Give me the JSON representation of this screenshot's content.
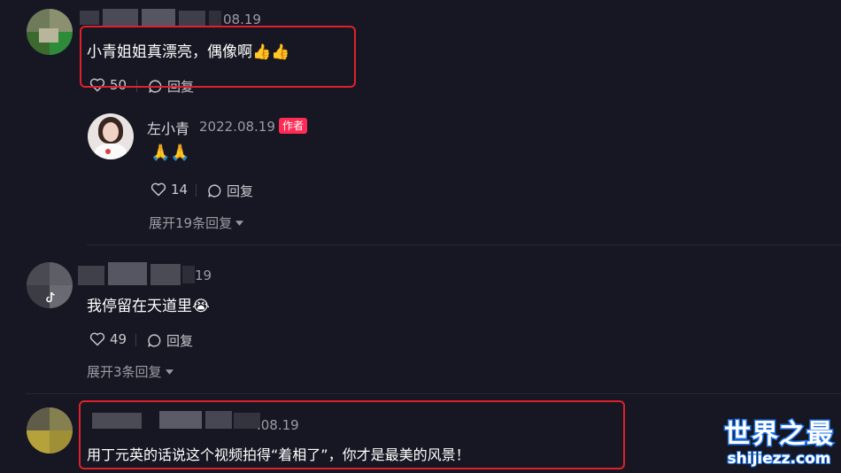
{
  "comments": [
    {
      "date_fragment": "08.19",
      "text": "小青姐姐真漂亮，偶像啊👍👍",
      "likes": "50",
      "reply_label": "回复"
    },
    {
      "date_fragment": "19",
      "text": "我停留在天道里😭",
      "likes": "49",
      "reply_label": "回复",
      "expand_label": "展开3条回复"
    },
    {
      "date_fragment": ".08.19",
      "text": "用丁元英的话说这个视频拍得“着相了”，你才是最美的风景！"
    }
  ],
  "reply": {
    "username": "左小青",
    "date": "2022.08.19",
    "author_badge": "作者",
    "text": "🙏🙏",
    "likes": "14",
    "reply_label": "回复",
    "expand_label": "展开19条回复"
  },
  "watermark": {
    "title": "世界之最",
    "domain": "shijiezz.com"
  },
  "colors": {
    "background": "#161722",
    "highlight_box": "#e0202a",
    "author_badge": "#fe2c55",
    "watermark": "#1e73e8"
  },
  "icons": [
    "heart-icon",
    "comment-bubble-icon",
    "caret-down-icon",
    "tiktok-logo-icon"
  ]
}
